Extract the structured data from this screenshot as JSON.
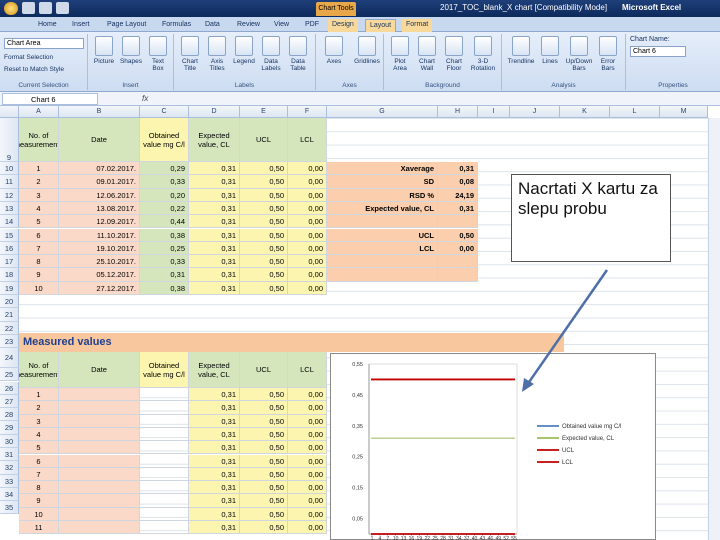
{
  "window": {
    "doc_title": "2017_TOC_blank_X chart [Compatibility Mode]",
    "app_name": "Microsoft Excel",
    "context_tab": "Chart Tools"
  },
  "tabs": [
    {
      "label": "Home"
    },
    {
      "label": "Insert"
    },
    {
      "label": "Page Layout"
    },
    {
      "label": "Formulas"
    },
    {
      "label": "Data"
    },
    {
      "label": "Review"
    },
    {
      "label": "View"
    },
    {
      "label": "PDF"
    },
    {
      "label": "Design"
    },
    {
      "label": "Layout"
    },
    {
      "label": "Format"
    }
  ],
  "ribbon": {
    "current_selection": {
      "dropdown": "Chart Area",
      "format_selection": "Format Selection",
      "reset": "Reset to Match Style",
      "group": "Current Selection"
    },
    "insert": {
      "buttons": [
        "Picture",
        "Shapes",
        "Text Box"
      ],
      "group": "Insert"
    },
    "labels": {
      "buttons": [
        "Chart Title",
        "Axis Titles",
        "Legend",
        "Data Labels",
        "Data Table"
      ],
      "group": "Labels"
    },
    "axes": {
      "buttons": [
        "Axes",
        "Gridlines"
      ],
      "group": "Axes"
    },
    "background": {
      "buttons": [
        "Plot Area",
        "Chart Wall",
        "Chart Floor",
        "3-D Rotation"
      ],
      "group": "Background"
    },
    "analysis": {
      "buttons": [
        "Trendline",
        "Lines",
        "Up/Down Bars",
        "Error Bars"
      ],
      "group": "Analysis"
    },
    "properties": {
      "chart_name_label": "Chart Name:",
      "chart_name": "Chart 6",
      "group": "Properties"
    }
  },
  "formula_bar": {
    "name_box": "Chart 6",
    "fx": "fx"
  },
  "columns": [
    "A",
    "B",
    "C",
    "D",
    "E",
    "F",
    "G",
    "H",
    "I",
    "J",
    "K",
    "L",
    "M"
  ],
  "rows_top": [
    "9",
    "10",
    "11",
    "12",
    "13",
    "14",
    "15",
    "16",
    "17",
    "18",
    "19",
    "20",
    "21",
    "22",
    "23",
    "24",
    "25",
    "26",
    "27",
    "28",
    "29",
    "30",
    "31",
    "32",
    "33",
    "34",
    "35"
  ],
  "headers": {
    "no": "No. of measurements",
    "date": "Date",
    "obtained": "Obtained value mg C/l",
    "expected": "Expected value, CL",
    "ucl": "UCL",
    "lcl": "LCL"
  },
  "top_table": [
    [
      "1",
      "07.02.2017.",
      "0,29",
      "0,31",
      "0,50",
      "0,00"
    ],
    [
      "2",
      "09.01.2017.",
      "0,33",
      "0,31",
      "0,50",
      "0,00"
    ],
    [
      "3",
      "12.06.2017.",
      "0,20",
      "0,31",
      "0,50",
      "0,00"
    ],
    [
      "4",
      "13.08.2017.",
      "0,22",
      "0,31",
      "0,50",
      "0,00"
    ],
    [
      "5",
      "12.09.2017.",
      "0,44",
      "0,31",
      "0,50",
      "0,00"
    ],
    [
      "6",
      "11.10.2017.",
      "0,38",
      "0,31",
      "0,50",
      "0,00"
    ],
    [
      "7",
      "19.10.2017.",
      "0,25",
      "0,31",
      "0,50",
      "0,00"
    ],
    [
      "8",
      "25.10.2017.",
      "0,33",
      "0,31",
      "0,50",
      "0,00"
    ],
    [
      "9",
      "05.12.2017.",
      "0,31",
      "0,31",
      "0,50",
      "0,00"
    ],
    [
      "10",
      "27.12.2017.",
      "0,38",
      "0,31",
      "0,50",
      "0,00"
    ]
  ],
  "stats": [
    {
      "label": "Xaverage",
      "value": "0,31"
    },
    {
      "label": "SD",
      "value": "0,08"
    },
    {
      "label": "RSD %",
      "value": "24,19"
    },
    {
      "label": "Expected value, CL",
      "value": "0,31"
    },
    {
      "label": "",
      "value": ""
    },
    {
      "label": "UCL",
      "value": "0,50"
    },
    {
      "label": "LCL",
      "value": "0,00"
    }
  ],
  "section_title": "Measured values",
  "bottom_table": [
    [
      "1",
      "",
      "",
      "0,31",
      "0,50",
      "0,00"
    ],
    [
      "2",
      "",
      "",
      "0,31",
      "0,50",
      "0,00"
    ],
    [
      "3",
      "",
      "",
      "0,31",
      "0,50",
      "0,00"
    ],
    [
      "4",
      "",
      "",
      "0,31",
      "0,50",
      "0,00"
    ],
    [
      "5",
      "",
      "",
      "0,31",
      "0,50",
      "0,00"
    ],
    [
      "6",
      "",
      "",
      "0,31",
      "0,50",
      "0,00"
    ],
    [
      "7",
      "",
      "",
      "0,31",
      "0,50",
      "0,00"
    ],
    [
      "8",
      "",
      "",
      "0,31",
      "0,50",
      "0,00"
    ],
    [
      "9",
      "",
      "",
      "0,31",
      "0,50",
      "0,00"
    ],
    [
      "10",
      "",
      "",
      "0,31",
      "0,50",
      "0,00"
    ],
    [
      "11",
      "",
      "",
      "0,31",
      "0,50",
      "0,00"
    ]
  ],
  "callout": "Nacrtati X kartu za slepu probu",
  "chart_data": {
    "type": "line",
    "x": [
      1,
      2,
      3,
      4,
      5,
      6,
      7,
      8,
      9,
      10,
      11,
      12,
      13,
      14,
      15,
      16,
      17,
      18,
      19,
      20,
      21,
      22,
      23,
      24,
      25,
      26,
      27
    ],
    "x_ticks": [
      "1",
      "4",
      "7",
      "10",
      "13",
      "16",
      "19",
      "22",
      "25",
      "28",
      "31",
      "34",
      "37",
      "40",
      "43",
      "46",
      "49",
      "52",
      "55"
    ],
    "y_ticks": [
      "0,05",
      "0,15",
      "0,25",
      "0,35",
      "0,45",
      "0,55"
    ],
    "ylim": [
      0.0,
      0.55
    ],
    "series": [
      {
        "name": "Obtained value mg C/l",
        "color": "#4f81bd",
        "values": []
      },
      {
        "name": "Expected value, CL",
        "color": "#9bbb59",
        "constant": 0.31
      },
      {
        "name": "UCL",
        "color": "#c00000",
        "constant": 0.5
      },
      {
        "name": "LCL",
        "color": "#c00000",
        "constant": 0.0
      }
    ],
    "grid": false,
    "legend": "right"
  }
}
